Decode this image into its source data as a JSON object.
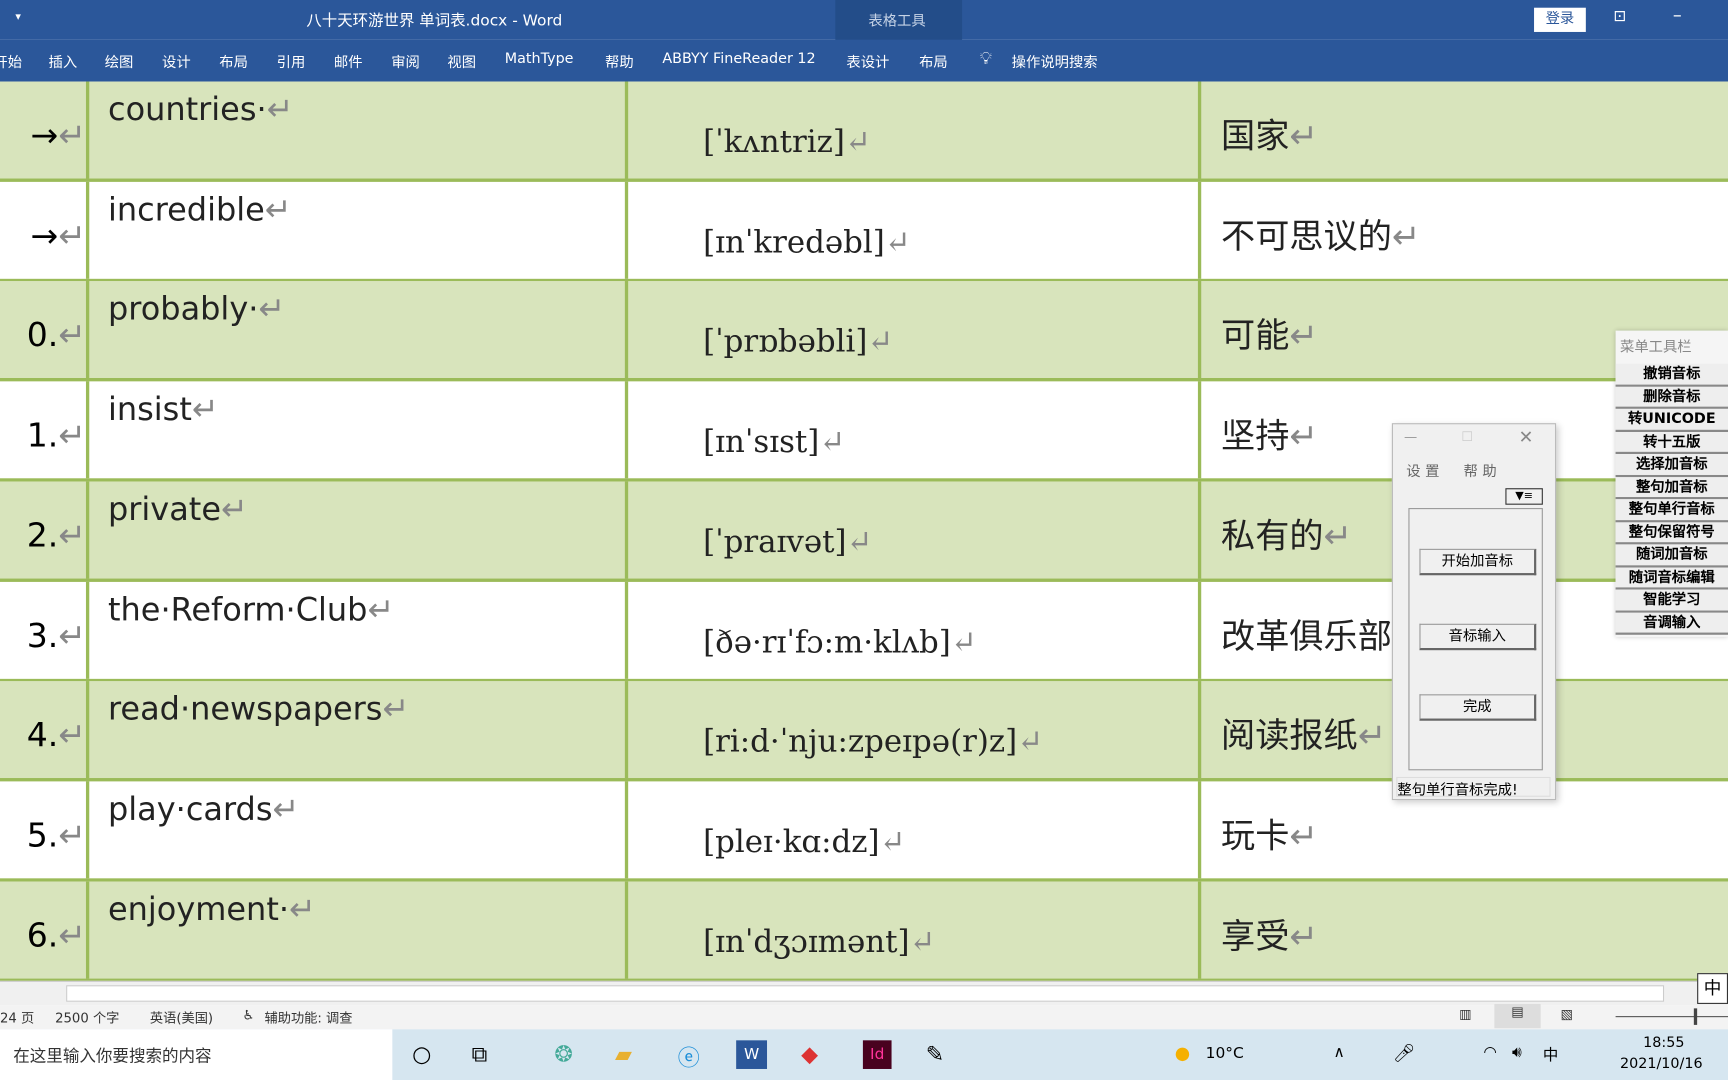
{
  "window": {
    "title": "八十天环游世界 单词表.docx  -  Word",
    "context_tab": "表格工具",
    "login": "登录"
  },
  "ribbon": {
    "tabs": [
      "开始",
      "插入",
      "绘图",
      "设计",
      "布局",
      "引用",
      "邮件",
      "审阅",
      "视图",
      "MathType",
      "帮助",
      "ABBYY FineReader 12",
      "表设计",
      "布局"
    ],
    "tell_me": "操作说明搜索"
  },
  "rows": [
    {
      "num": "→",
      "word": "countries·",
      "ipa": "[ˈkʌntriz]",
      "cn": "国家"
    },
    {
      "num": "→",
      "word": "incredible",
      "ipa": "[ɪnˈkredəbl]",
      "cn": "不可思议的"
    },
    {
      "num": "0.",
      "word": "probably·",
      "ipa": "[ˈprɒbəbli]",
      "cn": "可能"
    },
    {
      "num": "1.",
      "word": "insist",
      "ipa": "[ɪnˈsɪst]",
      "cn": "坚持"
    },
    {
      "num": "2.",
      "word": "private",
      "ipa": "[ˈpraɪvət]",
      "cn": "私有的"
    },
    {
      "num": "3.",
      "word": "the·Reform·Club",
      "ipa": "[ðə·rɪˈfɔ:m·klʌb]",
      "cn": "改革俱乐部"
    },
    {
      "num": "4.",
      "word": "read·newspapers",
      "ipa": "[ri:d·ˈnju:zpeɪpə(r)z]",
      "cn": "阅读报纸"
    },
    {
      "num": "5.",
      "word": "play·cards",
      "ipa": "[pleɪ·kɑ:dz]",
      "cn": "玩卡"
    },
    {
      "num": "6.",
      "word": "enjoyment·",
      "ipa": "[ɪnˈdʒɔɪmənt]",
      "cn": "享受"
    }
  ],
  "status": {
    "pages": "24 页",
    "words": "2500 个字",
    "language": "英语(美国)",
    "accessibility": "辅助功能: 调查"
  },
  "taskbar": {
    "search_placeholder": "在这里输入你要搜索的内容",
    "weather": "10°C",
    "time": "18:55",
    "date": "2021/10/16",
    "ime": "中"
  },
  "dialog": {
    "menu": [
      "设 置",
      "帮 助"
    ],
    "buttons": [
      "开始加音标",
      "音标输入",
      "完成"
    ],
    "status": "整句单行音标完成!"
  },
  "toolbar": {
    "title": "菜单工具栏",
    "items": [
      "撤销音标",
      "删除音标",
      "转UNICODE",
      "转十五版",
      "选择加音标",
      "整句加音标",
      "整句单行音标",
      "整句保留符号",
      "随词加音标",
      "随词音标编辑",
      "智能学习",
      "音调输入"
    ]
  },
  "colors": {
    "accent": "#2b579a",
    "row_green": "#d8e4bc",
    "border": "#9bbb59"
  }
}
